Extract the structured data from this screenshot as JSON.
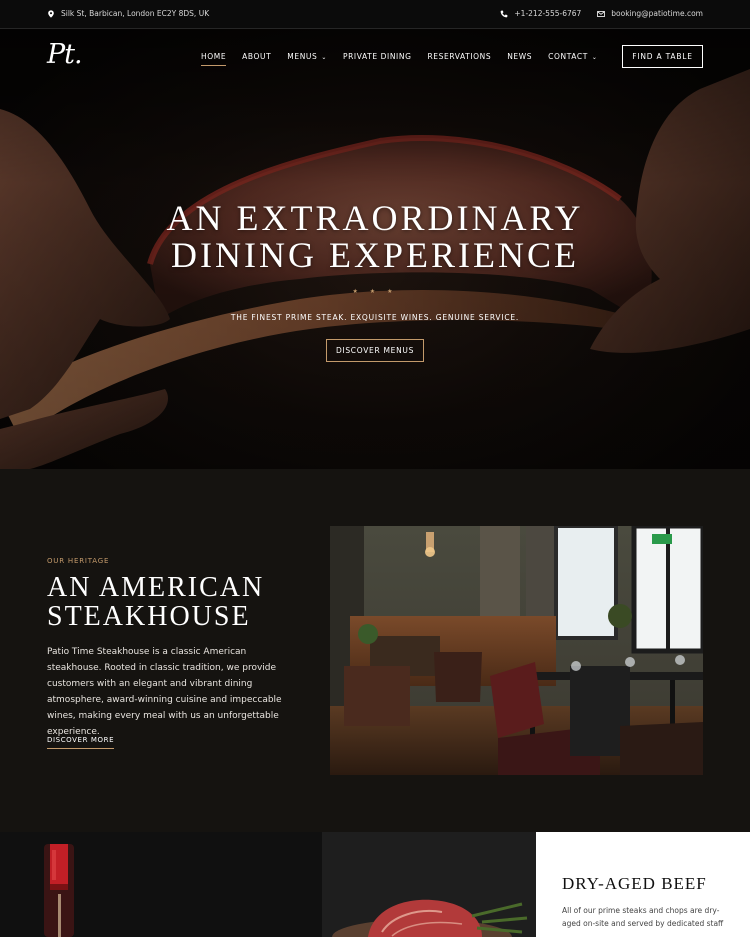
{
  "topbar": {
    "address": "Silk St, Barbican, London EC2Y 8DS, UK",
    "phone": "+1-212-555-6767",
    "email": "booking@patiotime.com",
    "icons": [
      "map-pin-icon",
      "phone-icon",
      "mail-icon"
    ]
  },
  "nav": {
    "logo": "Pt.",
    "items": [
      {
        "label": "HOME",
        "active": true
      },
      {
        "label": "ABOUT"
      },
      {
        "label": "MENUS",
        "dropdown": true
      },
      {
        "label": "PRIVATE DINING"
      },
      {
        "label": "RESERVATIONS"
      },
      {
        "label": "NEWS"
      },
      {
        "label": "CONTACT",
        "dropdown": true
      }
    ],
    "cta": "FIND A TABLE"
  },
  "hero": {
    "title_line1": "AN EXTRAORDINARY",
    "title_line2": "DINING EXPERIENCE",
    "stars": "★ ★ ★",
    "tagline": "THE FINEST PRIME STEAK. EXQUISITE WINES. GENUINE SERVICE.",
    "button": "DISCOVER MENUS"
  },
  "heritage": {
    "eyebrow": "OUR HERITAGE",
    "title_line1": "AN AMERICAN",
    "title_line2": "STEAKHOUSE",
    "text": "Patio Time Steakhouse is a classic American steakhouse. Rooted in classic tradition, we provide customers with an elegant and vibrant dining atmosphere, award-winning cuisine and impeccable wines, making every meal with us an unforgettable experience.",
    "link": "DISCOVER MORE"
  },
  "feature": {
    "title": "DRY-AGED BEEF",
    "text": "All of our prime steaks and chops are dry-aged on-site and served by dedicated staff"
  },
  "colors": {
    "accent": "#c39a6b",
    "dark": "#151310",
    "black": "#0b0b0b"
  }
}
